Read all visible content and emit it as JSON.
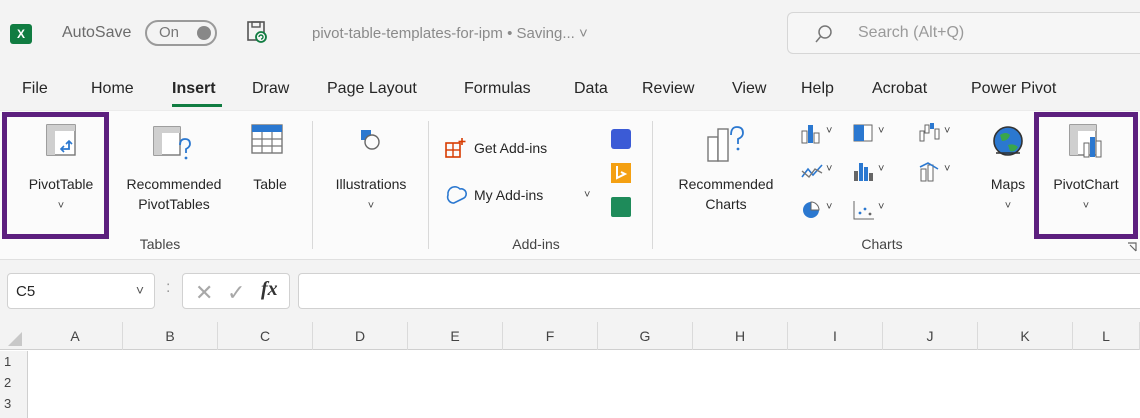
{
  "titlebar": {
    "app_logo": "X",
    "autosave_label": "AutoSave",
    "autosave_state": "On",
    "filename": "pivot-table-templates-for-ipm • Saving... ˅",
    "search_placeholder": "Search (Alt+Q)"
  },
  "menu": [
    "File",
    "Home",
    "Insert",
    "Draw",
    "Page Layout",
    "Formulas",
    "Data",
    "Review",
    "View",
    "Help",
    "Acrobat",
    "Power Pivot"
  ],
  "menu_active": "Insert",
  "ribbon": {
    "pivottable": "PivotTable",
    "recommended_pivottables_1": "Recommended",
    "recommended_pivottables_2": "PivotTables",
    "table": "Table",
    "tables_group": "Tables",
    "illustrations": "Illustrations",
    "get_addins": "Get Add-ins",
    "my_addins": "My Add-ins",
    "addins_group": "Add-ins",
    "recommended_charts_1": "Recommended",
    "recommended_charts_2": "Charts",
    "maps": "Maps",
    "pivotchart": "PivotChart",
    "charts_group": "Charts",
    "caret": "˅"
  },
  "formula_bar": {
    "name_box": "C5",
    "name_caret": "˅",
    "separator": ":",
    "cancel": "✕",
    "enter": "✓",
    "fx": "fx",
    "formula": ""
  },
  "grid": {
    "columns": [
      "A",
      "B",
      "C",
      "D",
      "E",
      "F",
      "G",
      "H",
      "I",
      "J",
      "K",
      "L"
    ],
    "rows": [
      "1",
      "2",
      "3"
    ]
  },
  "colors": {
    "excel_green": "#107c41",
    "highlight_purple": "#5c1f7e"
  }
}
